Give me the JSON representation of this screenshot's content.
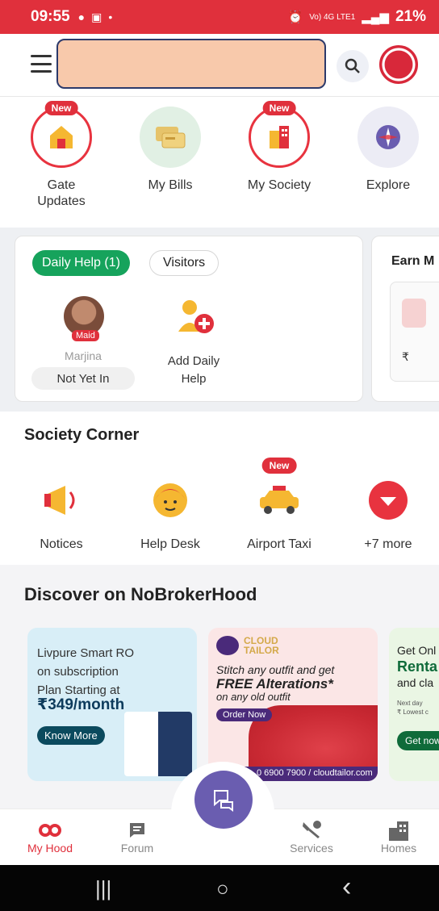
{
  "status_bar": {
    "time": "09:55",
    "battery": "21%",
    "network": "Vo) 4G LTE1",
    "colors": {
      "background": "#e0303c"
    }
  },
  "top_bar": {
    "menu_icon": "hamburger-icon",
    "search_icon": "search-icon",
    "avatar_icon": "profile-avatar",
    "redacted_search_color": "#f8c9ab"
  },
  "quick_actions": [
    {
      "label": "Gate Updates",
      "badge": "New",
      "icon": "house-icon"
    },
    {
      "label": "My Bills",
      "badge": "",
      "icon": "bill-cards-icon",
      "highlighted": true
    },
    {
      "label": "My Society",
      "badge": "New",
      "icon": "building-icon"
    },
    {
      "label": "Explore",
      "badge": "",
      "icon": "compass-icon"
    }
  ],
  "daily_help": {
    "tabs": [
      "Daily Help (1)",
      "Visitors"
    ],
    "maid": {
      "tag": "Maid",
      "name": "Marjina",
      "status": "Not Yet In"
    },
    "add_label_line1": "Add Daily",
    "add_label_line2": "Help"
  },
  "earn_card": {
    "title": "Earn M",
    "amount_partial": "₹"
  },
  "society_corner": {
    "title": "Society Corner",
    "items": [
      {
        "label": "Notices",
        "icon": "megaphone-icon",
        "badge": ""
      },
      {
        "label": "Help Desk",
        "icon": "support-agent-icon",
        "badge": ""
      },
      {
        "label": "Airport Taxi",
        "icon": "taxi-icon",
        "badge": "New"
      },
      {
        "label": "+7 more",
        "icon": "chevron-down-circle-icon",
        "badge": ""
      }
    ]
  },
  "discover": {
    "title": "Discover on NoBrokerHood",
    "banners": [
      {
        "line1": "Livpure Smart RO",
        "line2": "on subscription",
        "line3": "Plan Starting at",
        "price": "₹349/month",
        "button": "Know More"
      },
      {
        "brand_line1": "CLOUD",
        "brand_line2": "TAILOR",
        "line1": "Stitch any outfit and get",
        "line2": "FREE Alterations*",
        "line3": "on any old outfit",
        "button": "Order Now",
        "footer": "0 6900 7900 / cloudtailor.com"
      },
      {
        "line1": "Get Onl",
        "line2": "Renta",
        "line3": "and cla",
        "small1": "Next day",
        "small2": "₹ Lowest c",
        "button": "Get now"
      }
    ]
  },
  "bottom_nav": [
    {
      "label": "My Hood",
      "icon": "infinity-icon",
      "active": true
    },
    {
      "label": "Forum",
      "icon": "chat-icon",
      "active": false
    },
    {
      "label": "Services",
      "icon": "tools-icon",
      "active": false
    },
    {
      "label": "Homes",
      "icon": "buildings-icon",
      "active": false
    }
  ],
  "fab_icon": "chat-swap-icon",
  "system_nav": {
    "recents": "|||",
    "home": "○",
    "back": "‹"
  }
}
